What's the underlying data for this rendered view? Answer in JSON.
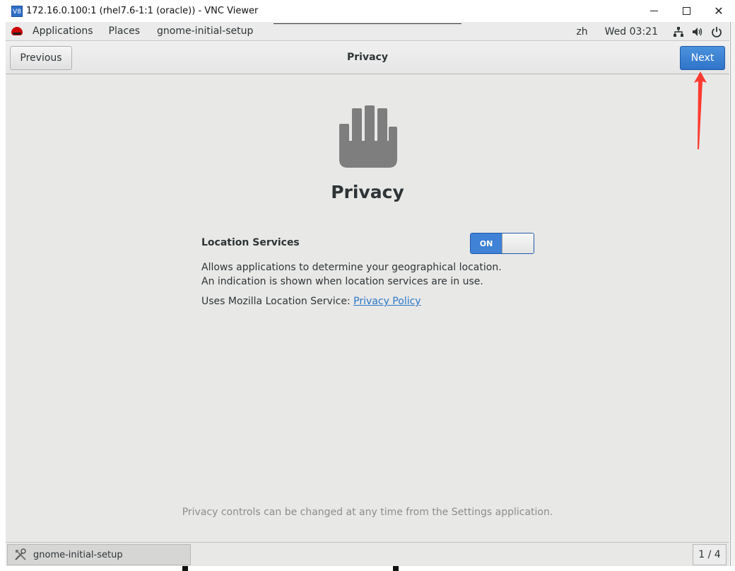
{
  "window": {
    "app_icon": "V8",
    "title": "172.16.0.100:1 (rhel7.6-1:1 (oracle)) - VNC Viewer",
    "controls": {
      "minimize": "minimize-icon",
      "maximize": "maximize-icon",
      "close": "✕"
    }
  },
  "topbar": {
    "applications": "Applications",
    "places": "Places",
    "app_name": "gnome-initial-setup",
    "input_lang": "zh",
    "clock": "Wed 03:21"
  },
  "headerbar": {
    "previous_label": "Previous",
    "title": "Privacy",
    "next_label": "Next"
  },
  "main": {
    "heading": "Privacy",
    "location_label": "Location Services",
    "switch_state": "ON",
    "description": "Allows applications to determine your geographical location. An indication is shown when location services are in use.",
    "uses_prefix": "Uses Mozilla Location Service: ",
    "privacy_link": "Privacy Policy",
    "footer_note": "Privacy controls can be changed at any time from the Settings application."
  },
  "taskbar": {
    "task_label": "gnome-initial-setup",
    "workspace": "1 / 4"
  },
  "colors": {
    "accent": "#3f82d6",
    "annotation": "#ff3b30",
    "icon_gray": "#7e7e7e"
  }
}
